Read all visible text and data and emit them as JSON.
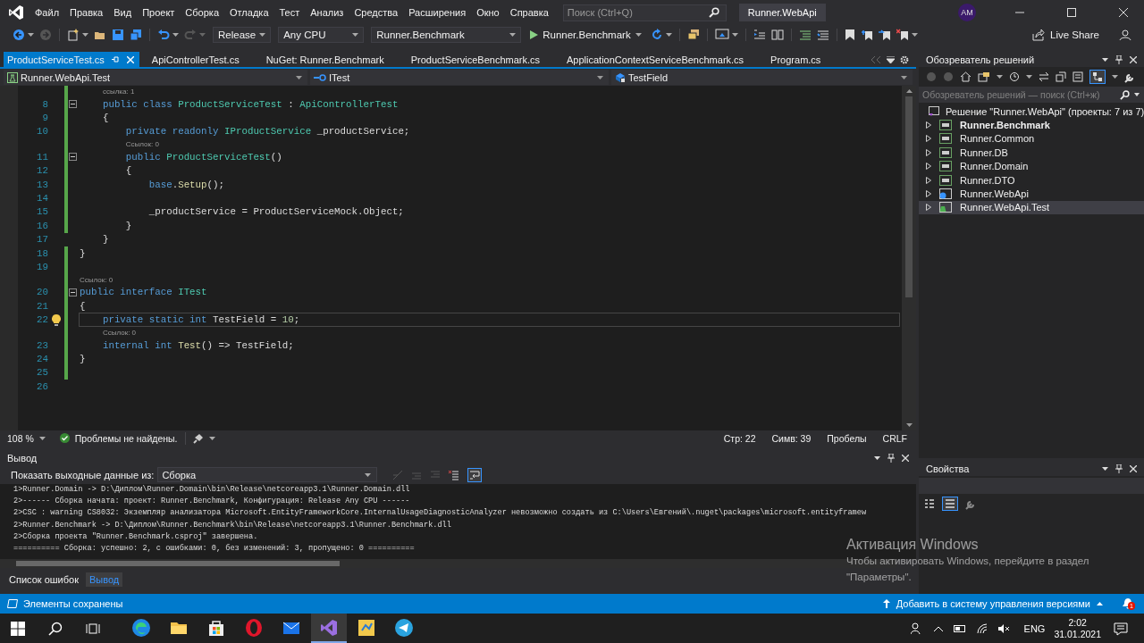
{
  "menu": [
    "Файл",
    "Правка",
    "Вид",
    "Проект",
    "Сборка",
    "Отладка",
    "Тест",
    "Анализ",
    "Средства",
    "Расширения",
    "Окно",
    "Справка"
  ],
  "search": {
    "placeholder": "Поиск (Ctrl+Q)"
  },
  "solution_title": "Runner.WebApi",
  "avatar": "AM",
  "toolbar": {
    "configuration": "Release",
    "platform": "Any CPU",
    "startup_project": "Runner.Benchmark",
    "start": "Runner.Benchmark",
    "live_share": "Live Share"
  },
  "tabs": [
    {
      "label": "ProductServiceTest.cs",
      "selected": true
    },
    {
      "label": "ApiControllerTest.cs",
      "selected": false
    },
    {
      "label": "NuGet: Runner.Benchmark",
      "selected": false
    },
    {
      "label": "ProductServiceBenchmark.cs",
      "selected": false
    },
    {
      "label": "ApplicationContextServiceBenchmark.cs",
      "selected": false
    },
    {
      "label": "Program.cs",
      "selected": false
    }
  ],
  "navigation": {
    "project": "Runner.WebApi.Test",
    "type": "ITest",
    "member": "TestField"
  },
  "code": [
    {
      "kind": "lens",
      "changed": true,
      "text": "ссылка: 1"
    },
    {
      "kind": "code",
      "number": "8",
      "changed": true,
      "fold": true,
      "tokens": [
        {
          "kind": "keyword",
          "text": "    public class "
        },
        {
          "kind": "type",
          "text": "ProductServiceTest"
        },
        {
          "kind": "plain",
          "text": " : "
        },
        {
          "kind": "type",
          "text": "ApiControllerTest"
        }
      ]
    },
    {
      "kind": "code",
      "number": "9",
      "changed": true,
      "tokens": [
        {
          "kind": "plain",
          "text": "    {"
        }
      ]
    },
    {
      "kind": "code",
      "number": "10",
      "changed": true,
      "tokens": [
        {
          "kind": "keyword",
          "text": "        private readonly "
        },
        {
          "kind": "type",
          "text": "IProductService"
        },
        {
          "kind": "plain",
          "text": " _productService;"
        }
      ]
    },
    {
      "kind": "lens",
      "changed": true,
      "text": "Ссылок: 0"
    },
    {
      "kind": "code",
      "number": "11",
      "changed": true,
      "fold": true,
      "tokens": [
        {
          "kind": "keyword",
          "text": "        public "
        },
        {
          "kind": "type",
          "text": "ProductServiceTest"
        },
        {
          "kind": "plain",
          "text": "()"
        }
      ]
    },
    {
      "kind": "code",
      "number": "12",
      "changed": true,
      "tokens": [
        {
          "kind": "plain",
          "text": "        {"
        }
      ]
    },
    {
      "kind": "code",
      "number": "13",
      "changed": true,
      "tokens": [
        {
          "kind": "keyword",
          "text": "            base"
        },
        {
          "kind": "plain",
          "text": "."
        },
        {
          "kind": "method",
          "text": "Setup"
        },
        {
          "kind": "plain",
          "text": "();"
        }
      ]
    },
    {
      "kind": "code",
      "number": "14",
      "changed": true
    },
    {
      "kind": "code",
      "number": "15",
      "changed": true,
      "tokens": [
        {
          "kind": "plain",
          "text": "            _productService = ProductServiceMock.Object;"
        }
      ]
    },
    {
      "kind": "code",
      "number": "16",
      "changed": true,
      "tokens": [
        {
          "kind": "plain",
          "text": "        }"
        }
      ]
    },
    {
      "kind": "code",
      "number": "17",
      "changed": false,
      "tokens": [
        {
          "kind": "plain",
          "text": "    }"
        }
      ]
    },
    {
      "kind": "code",
      "number": "18",
      "changed": true,
      "tokens": [
        {
          "kind": "plain",
          "text": "}"
        }
      ]
    },
    {
      "kind": "code",
      "number": "19",
      "changed": true
    },
    {
      "kind": "lens",
      "changed": true,
      "text": "Ссылок: 0"
    },
    {
      "kind": "code",
      "number": "20",
      "changed": true,
      "fold": true,
      "tokens": [
        {
          "kind": "keyword",
          "text": "public interface "
        },
        {
          "kind": "type",
          "text": "ITest"
        }
      ]
    },
    {
      "kind": "code",
      "number": "21",
      "changed": true,
      "tokens": [
        {
          "kind": "plain",
          "text": "{"
        }
      ]
    },
    {
      "kind": "code",
      "number": "22",
      "changed": true,
      "current": true,
      "tokens": [
        {
          "kind": "keyword",
          "text": "    private static int "
        },
        {
          "kind": "plain",
          "text": "TestField = "
        },
        {
          "kind": "number",
          "text": "10"
        },
        {
          "kind": "plain",
          "text": ";"
        }
      ]
    },
    {
      "kind": "lens",
      "changed": true,
      "text": "Ссылок: 0"
    },
    {
      "kind": "code",
      "number": "23",
      "changed": true,
      "tokens": [
        {
          "kind": "keyword",
          "text": "    internal int "
        },
        {
          "kind": "method",
          "text": "Test"
        },
        {
          "kind": "plain",
          "text": "() => TestField;"
        }
      ]
    },
    {
      "kind": "code",
      "number": "24",
      "changed": true,
      "tokens": [
        {
          "kind": "plain",
          "text": "}"
        }
      ]
    },
    {
      "kind": "code",
      "number": "25",
      "changed": true
    },
    {
      "kind": "code",
      "number": "26",
      "changed": false
    }
  ],
  "editor_status": {
    "zoom": "108 %",
    "issues": "Проблемы не найдены.",
    "line": "Стр: 22",
    "column": "Симв: 39",
    "whitespace": "Пробелы",
    "line_endings": "CRLF"
  },
  "output": {
    "title": "Вывод",
    "show_label": "Показать выходные данные из:",
    "source": "Сборка",
    "lines": [
      "1>Runner.Domain -> D:\\Диплом\\Runner.Domain\\bin\\Release\\netcoreapp3.1\\Runner.Domain.dll",
      "2>------ Сборка начата: проект: Runner.Benchmark, Конфигурация: Release Any CPU ------",
      "2>CSC : warning CS8032: Экземпляр анализатора Microsoft.EntityFrameworkCore.InternalUsageDiagnosticAnalyzer невозможно создать из C:\\Users\\Евгений\\.nuget\\packages\\microsoft.entityframew",
      "2>Runner.Benchmark -> D:\\Диплом\\Runner.Benchmark\\bin\\Release\\netcoreapp3.1\\Runner.Benchmark.dll",
      "2>Сборка проекта \"Runner.Benchmark.csproj\" завершена.",
      "========== Сборка: успешно: 2, с ошибками: 0, без изменений: 3, пропущено: 0 =========="
    ]
  },
  "bottom_tabs": [
    {
      "label": "Список ошибок",
      "selected": false
    },
    {
      "label": "Вывод",
      "selected": true
    }
  ],
  "solution_explorer": {
    "title": "Обозреватель решений",
    "search_placeholder": "Обозреватель решений — поиск (Ctrl+ж)",
    "solution": "Решение \"Runner.WebApi\" (проекты: 7 из 7)",
    "projects": [
      {
        "name": "Runner.Benchmark",
        "kind": "csharp",
        "startup": true,
        "selected": false
      },
      {
        "name": "Runner.Common",
        "kind": "csharp",
        "startup": false,
        "selected": false
      },
      {
        "name": "Runner.DB",
        "kind": "csharp",
        "startup": false,
        "selected": false
      },
      {
        "name": "Runner.Domain",
        "kind": "csharp",
        "startup": false,
        "selected": false
      },
      {
        "name": "Runner.DTO",
        "kind": "csharp",
        "startup": false,
        "selected": false
      },
      {
        "name": "Runner.WebApi",
        "kind": "web",
        "startup": false,
        "selected": false
      },
      {
        "name": "Runner.WebApi.Test",
        "kind": "test",
        "startup": false,
        "selected": true
      }
    ]
  },
  "properties": {
    "title": "Свойства"
  },
  "activation": {
    "title": "Активация Windows",
    "text": "Чтобы активировать Windows, перейдите в раздел \"Параметры\"."
  },
  "status_bar": {
    "message": "Элементы сохранены",
    "source_control": "Добавить в систему управления версиями",
    "notifications": "1"
  },
  "taskbar": {
    "apps": [
      {
        "kind": "edge",
        "selected": false
      },
      {
        "kind": "explorer",
        "selected": false
      },
      {
        "kind": "store",
        "selected": false
      },
      {
        "kind": "opera",
        "selected": false
      },
      {
        "kind": "mail",
        "selected": false
      },
      {
        "kind": "vs",
        "selected": true
      },
      {
        "kind": "app",
        "selected": false
      },
      {
        "kind": "telegram",
        "selected": false
      }
    ],
    "language": "ENG",
    "time": "2:02",
    "date": "31.01.2021"
  }
}
